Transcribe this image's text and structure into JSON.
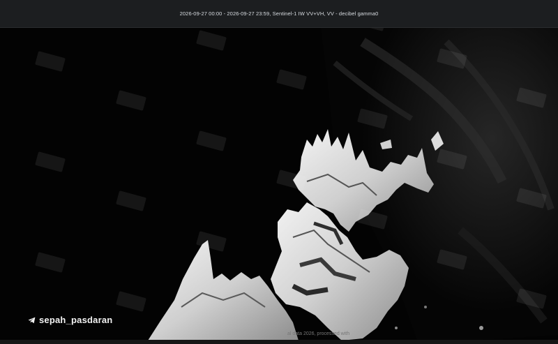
{
  "header": {
    "title": "2026-09-27 00:00 - 2026-09-27 23:59, Sentinel-1 IW VV+VH, VV - decibel gamma0"
  },
  "overlay": {
    "handle": "sepah_pasdaran",
    "handle_icon": "telegram-icon",
    "attribution_fragment": "al data 2026, processed with"
  },
  "colors": {
    "title_bar": "#1c1e20",
    "background": "#020202",
    "land_highlight": "#e8e8e8"
  }
}
